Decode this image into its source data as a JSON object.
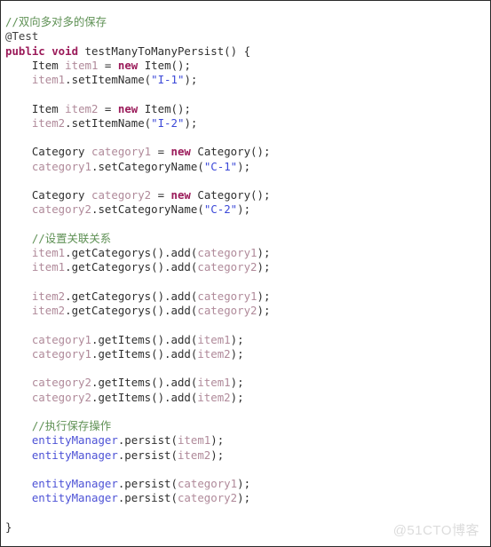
{
  "document": {
    "kind": "source-code-screenshot",
    "language": "Java",
    "watermark": "@51CTO博客",
    "background_color": "#ffffff",
    "border_color": "#2b2b2b",
    "syntax_colors": {
      "comment": "#5f9155",
      "keyword": "#9b1b5a",
      "variable": "#b08a9a",
      "string": "#3c49d8",
      "identifier": "#4d52d6",
      "plain": "#2f2f2f"
    }
  },
  "code": {
    "lines": [
      {
        "indent": 0,
        "tokens": [
          {
            "c": "comment",
            "t": "//双向多对多的保存"
          }
        ]
      },
      {
        "indent": 0,
        "tokens": [
          {
            "c": "anno",
            "t": "@Test"
          }
        ]
      },
      {
        "indent": 0,
        "tokens": [
          {
            "c": "keyword",
            "t": "public void"
          },
          {
            "c": "plain",
            "t": " "
          },
          {
            "c": "method",
            "t": "testManyToManyPersist() {"
          }
        ]
      },
      {
        "indent": 1,
        "tokens": [
          {
            "c": "type",
            "t": "Item "
          },
          {
            "c": "var",
            "t": "item1"
          },
          {
            "c": "plain",
            "t": " = "
          },
          {
            "c": "keyword",
            "t": "new"
          },
          {
            "c": "plain",
            "t": " Item();"
          }
        ]
      },
      {
        "indent": 1,
        "tokens": [
          {
            "c": "var",
            "t": "item1"
          },
          {
            "c": "plain",
            "t": ".setItemName("
          },
          {
            "c": "string",
            "t": "\"I-1\""
          },
          {
            "c": "plain",
            "t": ");"
          }
        ]
      },
      {
        "indent": 0,
        "tokens": []
      },
      {
        "indent": 1,
        "tokens": [
          {
            "c": "type",
            "t": "Item "
          },
          {
            "c": "var",
            "t": "item2"
          },
          {
            "c": "plain",
            "t": " = "
          },
          {
            "c": "keyword",
            "t": "new"
          },
          {
            "c": "plain",
            "t": " Item();"
          }
        ]
      },
      {
        "indent": 1,
        "tokens": [
          {
            "c": "var",
            "t": "item2"
          },
          {
            "c": "plain",
            "t": ".setItemName("
          },
          {
            "c": "string",
            "t": "\"I-2\""
          },
          {
            "c": "plain",
            "t": ");"
          }
        ]
      },
      {
        "indent": 0,
        "tokens": []
      },
      {
        "indent": 1,
        "tokens": [
          {
            "c": "type",
            "t": "Category "
          },
          {
            "c": "var",
            "t": "category1"
          },
          {
            "c": "plain",
            "t": " = "
          },
          {
            "c": "keyword",
            "t": "new"
          },
          {
            "c": "plain",
            "t": " Category();"
          }
        ]
      },
      {
        "indent": 1,
        "tokens": [
          {
            "c": "var",
            "t": "category1"
          },
          {
            "c": "plain",
            "t": ".setCategoryName("
          },
          {
            "c": "string",
            "t": "\"C-1\""
          },
          {
            "c": "plain",
            "t": ");"
          }
        ]
      },
      {
        "indent": 0,
        "tokens": []
      },
      {
        "indent": 1,
        "tokens": [
          {
            "c": "type",
            "t": "Category "
          },
          {
            "c": "var",
            "t": "category2"
          },
          {
            "c": "plain",
            "t": " = "
          },
          {
            "c": "keyword",
            "t": "new"
          },
          {
            "c": "plain",
            "t": " Category();"
          }
        ]
      },
      {
        "indent": 1,
        "tokens": [
          {
            "c": "var",
            "t": "category2"
          },
          {
            "c": "plain",
            "t": ".setCategoryName("
          },
          {
            "c": "string",
            "t": "\"C-2\""
          },
          {
            "c": "plain",
            "t": ");"
          }
        ]
      },
      {
        "indent": 0,
        "tokens": []
      },
      {
        "indent": 1,
        "tokens": [
          {
            "c": "comment",
            "t": "//设置关联关系"
          }
        ]
      },
      {
        "indent": 1,
        "tokens": [
          {
            "c": "var",
            "t": "item1"
          },
          {
            "c": "plain",
            "t": ".getCategorys().add("
          },
          {
            "c": "var",
            "t": "category1"
          },
          {
            "c": "plain",
            "t": ");"
          }
        ]
      },
      {
        "indent": 1,
        "tokens": [
          {
            "c": "var",
            "t": "item1"
          },
          {
            "c": "plain",
            "t": ".getCategorys().add("
          },
          {
            "c": "var",
            "t": "category2"
          },
          {
            "c": "plain",
            "t": ");"
          }
        ]
      },
      {
        "indent": 0,
        "tokens": []
      },
      {
        "indent": 1,
        "tokens": [
          {
            "c": "var",
            "t": "item2"
          },
          {
            "c": "plain",
            "t": ".getCategorys().add("
          },
          {
            "c": "var",
            "t": "category1"
          },
          {
            "c": "plain",
            "t": ");"
          }
        ]
      },
      {
        "indent": 1,
        "tokens": [
          {
            "c": "var",
            "t": "item2"
          },
          {
            "c": "plain",
            "t": ".getCategorys().add("
          },
          {
            "c": "var",
            "t": "category2"
          },
          {
            "c": "plain",
            "t": ");"
          }
        ]
      },
      {
        "indent": 0,
        "tokens": []
      },
      {
        "indent": 1,
        "tokens": [
          {
            "c": "var",
            "t": "category1"
          },
          {
            "c": "plain",
            "t": ".getItems().add("
          },
          {
            "c": "var",
            "t": "item1"
          },
          {
            "c": "plain",
            "t": ");"
          }
        ]
      },
      {
        "indent": 1,
        "tokens": [
          {
            "c": "var",
            "t": "category1"
          },
          {
            "c": "plain",
            "t": ".getItems().add("
          },
          {
            "c": "var",
            "t": "item2"
          },
          {
            "c": "plain",
            "t": ");"
          }
        ]
      },
      {
        "indent": 0,
        "tokens": []
      },
      {
        "indent": 1,
        "tokens": [
          {
            "c": "var",
            "t": "category2"
          },
          {
            "c": "plain",
            "t": ".getItems().add("
          },
          {
            "c": "var",
            "t": "item1"
          },
          {
            "c": "plain",
            "t": ");"
          }
        ]
      },
      {
        "indent": 1,
        "tokens": [
          {
            "c": "var",
            "t": "category2"
          },
          {
            "c": "plain",
            "t": ".getItems().add("
          },
          {
            "c": "var",
            "t": "item2"
          },
          {
            "c": "plain",
            "t": ");"
          }
        ]
      },
      {
        "indent": 0,
        "tokens": []
      },
      {
        "indent": 1,
        "tokens": [
          {
            "c": "comment",
            "t": "//执行保存操作"
          }
        ]
      },
      {
        "indent": 1,
        "tokens": [
          {
            "c": "ident",
            "t": "entityManager"
          },
          {
            "c": "plain",
            "t": ".persist("
          },
          {
            "c": "var",
            "t": "item1"
          },
          {
            "c": "plain",
            "t": ");"
          }
        ]
      },
      {
        "indent": 1,
        "tokens": [
          {
            "c": "ident",
            "t": "entityManager"
          },
          {
            "c": "plain",
            "t": ".persist("
          },
          {
            "c": "var",
            "t": "item2"
          },
          {
            "c": "plain",
            "t": ");"
          }
        ]
      },
      {
        "indent": 0,
        "tokens": []
      },
      {
        "indent": 1,
        "tokens": [
          {
            "c": "ident",
            "t": "entityManager"
          },
          {
            "c": "plain",
            "t": ".persist("
          },
          {
            "c": "var",
            "t": "category1"
          },
          {
            "c": "plain",
            "t": ");"
          }
        ]
      },
      {
        "indent": 1,
        "tokens": [
          {
            "c": "ident",
            "t": "entityManager"
          },
          {
            "c": "plain",
            "t": ".persist("
          },
          {
            "c": "var",
            "t": "category2"
          },
          {
            "c": "plain",
            "t": ");"
          }
        ]
      },
      {
        "indent": 0,
        "tokens": []
      },
      {
        "indent": 0,
        "tokens": [
          {
            "c": "plain",
            "t": "}"
          }
        ]
      }
    ]
  }
}
